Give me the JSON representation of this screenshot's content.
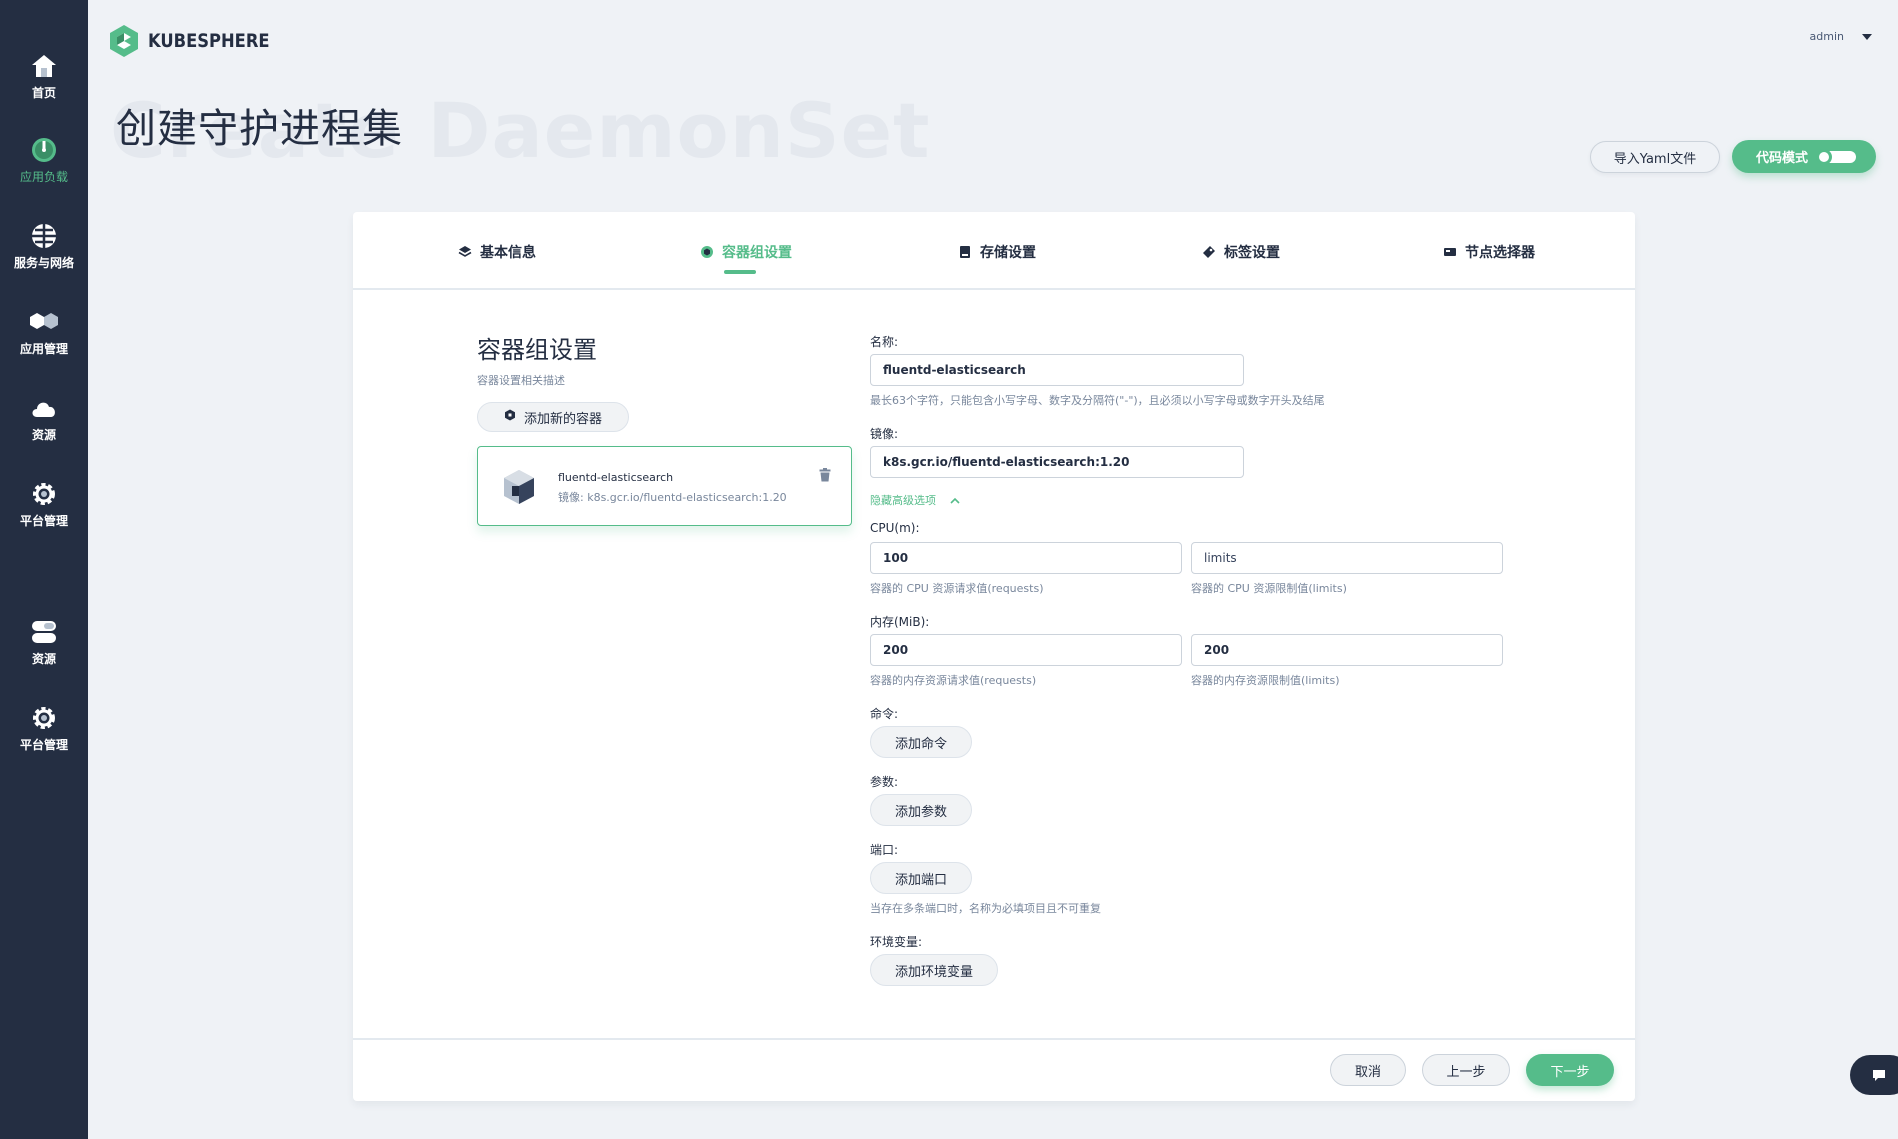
{
  "sidebar": {
    "items": [
      {
        "label": "首页",
        "icon": "home-icon"
      },
      {
        "label": "应用负载",
        "icon": "workload-gauge-icon",
        "active": true
      },
      {
        "label": "服务与网络",
        "icon": "network-icon"
      },
      {
        "label": "应用管理",
        "icon": "apps-icon"
      },
      {
        "label": "资源",
        "icon": "cloud-icon"
      },
      {
        "label": "平台管理",
        "icon": "gear-icon"
      },
      {
        "label": "资源",
        "icon": "storage-icon"
      },
      {
        "label": "平台管理",
        "icon": "gear-icon"
      }
    ]
  },
  "header": {
    "brand": "KUBESPHERE",
    "user": "admin",
    "title": "创建守护进程集",
    "title_watermark": "Create DaemonSet",
    "import_yaml": "导入Yaml文件",
    "code_mode": "代码模式"
  },
  "tabs": [
    {
      "label": "基本信息",
      "icon": "layers-icon"
    },
    {
      "label": "容器组设置",
      "icon": "pod-icon",
      "active": true
    },
    {
      "label": "存储设置",
      "icon": "storage-icon"
    },
    {
      "label": "标签设置",
      "icon": "tag-icon"
    },
    {
      "label": "节点选择器",
      "icon": "node-icon"
    }
  ],
  "section": {
    "title": "容器组设置",
    "desc": "容器设置相关描述",
    "add_container": "添加新的容器"
  },
  "container": {
    "name": "fluentd-elasticsearch",
    "image_line": "镜像: k8s.gcr.io/fluentd-elasticsearch:1.20"
  },
  "form": {
    "name_label": "名称:",
    "name_value": "fluentd-elasticsearch",
    "name_hint": "最长63个字符，只能包含小写字母、数字及分隔符(\"-\")，且必须以小写字母或数字开头及结尾",
    "image_label": "镜像:",
    "image_value": "k8s.gcr.io/fluentd-elasticsearch:1.20",
    "advanced_toggle": "隐藏高级选项",
    "cpu_label": "CPU(m):",
    "cpu_request": "100",
    "cpu_limit_placeholder": "limits",
    "cpu_request_hint": "容器的 CPU 资源请求值(requests)",
    "cpu_limit_hint": "容器的 CPU 资源限制值(limits)",
    "mem_label": "内存(MiB):",
    "mem_request": "200",
    "mem_limit": "200",
    "mem_request_hint": "容器的内存资源请求值(requests)",
    "mem_limit_hint": "容器的内存资源限制值(limits)",
    "command_label": "命令:",
    "add_command": "添加命令",
    "args_label": "参数:",
    "add_args": "添加参数",
    "port_label": "端口:",
    "add_port": "添加端口",
    "port_hint": "当存在多条端口时，名称为必填项目且不可重复",
    "env_label": "环境变量:",
    "add_env": "添加环境变量"
  },
  "footer": {
    "cancel": "取消",
    "prev": "上一步",
    "next": "下一步"
  },
  "colors": {
    "accent": "#55bc8a",
    "sidebar_bg": "#242e42",
    "page_bg": "#eff2f6"
  }
}
